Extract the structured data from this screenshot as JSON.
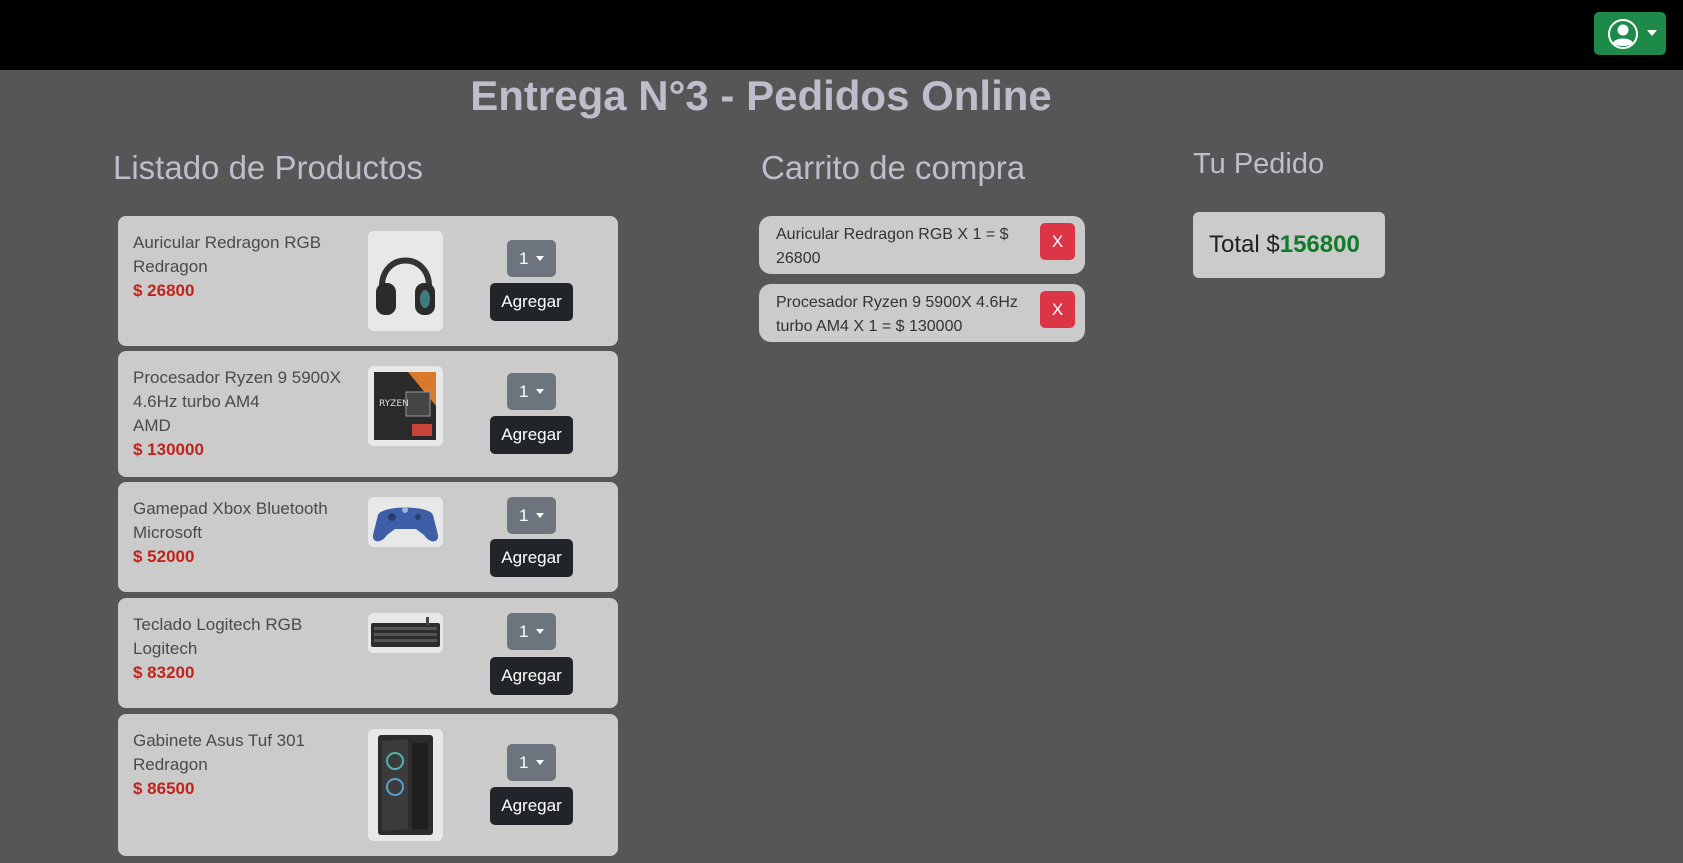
{
  "page": {
    "title": "Entrega N°3 - Pedidos Online"
  },
  "user_menu": {
    "icon": "user-circle-icon",
    "accent": "#1e8a4a"
  },
  "sections": {
    "products": "Listado de Productos",
    "cart": "Carrito de compra",
    "order": "Tu Pedido"
  },
  "products": [
    {
      "name": "Auricular Redragon RGB",
      "brand": "Redragon",
      "price": "$ 26800",
      "qty": "1",
      "add_label": "Agregar",
      "image": "headset-image"
    },
    {
      "name": "Procesador Ryzen 9 5900X 4.6Hz turbo AM4",
      "brand": "AMD",
      "price": "$ 130000",
      "qty": "1",
      "add_label": "Agregar",
      "image": "cpu-box-image"
    },
    {
      "name": "Gamepad Xbox Bluetooth",
      "brand": "Microsoft",
      "price": "$ 52000",
      "qty": "1",
      "add_label": "Agregar",
      "image": "gamepad-image"
    },
    {
      "name": "Teclado Logitech RGB",
      "brand": "Logitech",
      "price": "$ 83200",
      "qty": "1",
      "add_label": "Agregar",
      "image": "keyboard-image"
    },
    {
      "name": "Gabinete Asus Tuf 301",
      "brand": "Redragon",
      "price": "$ 86500",
      "qty": "1",
      "add_label": "Agregar",
      "image": "pc-case-image"
    }
  ],
  "cart": [
    {
      "text": "Auricular Redragon RGB X 1 = $ 26800",
      "remove_label": "X"
    },
    {
      "text": "Procesador Ryzen 9 5900X 4.6Hz turbo AM4 X 1 = $ 130000",
      "remove_label": "X"
    }
  ],
  "order": {
    "total_label": "Total $",
    "total_value": "156800"
  },
  "colors": {
    "background": "#565656",
    "price": "#c1231c",
    "remove": "#dc3545",
    "total": "#0f7a2a"
  }
}
